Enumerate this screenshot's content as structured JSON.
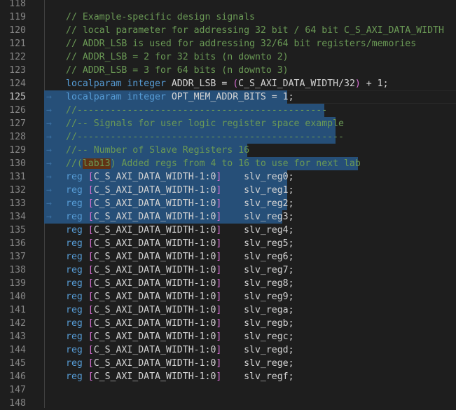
{
  "editor": {
    "lines": [
      {
        "n": "118",
        "parts": []
      },
      {
        "n": "119",
        "parts": [
          {
            "t": "// Example-specific design signals",
            "c": "comment"
          }
        ]
      },
      {
        "n": "120",
        "parts": [
          {
            "t": "// local parameter for addressing 32 bit / 64 bit C_S_AXI_DATA_WIDTH",
            "c": "comment"
          }
        ]
      },
      {
        "n": "121",
        "parts": [
          {
            "t": "// ADDR_LSB is used for addressing 32/64 bit registers/memories",
            "c": "comment"
          }
        ]
      },
      {
        "n": "122",
        "parts": [
          {
            "t": "// ADDR_LSB = 2 for 32 bits (n downto 2)",
            "c": "comment"
          }
        ]
      },
      {
        "n": "123",
        "parts": [
          {
            "t": "// ADDR_LSB = 3 for 64 bits (n downto 3)",
            "c": "comment"
          }
        ]
      },
      {
        "n": "124",
        "parts": [
          {
            "t": "localparam integer ",
            "c": "kw"
          },
          {
            "t": "ADDR_LSB = ",
            "c": "plain"
          },
          {
            "t": "(",
            "c": "bracket"
          },
          {
            "t": "C_S_AXI_DATA_WIDTH/32",
            "c": "plain"
          },
          {
            "t": ")",
            "c": "bracket"
          },
          {
            "t": " + 1;",
            "c": "plain"
          }
        ]
      },
      {
        "n": "125",
        "active": true,
        "sel": [
          0,
          347
        ],
        "parts": [
          {
            "t": "localparam integer ",
            "c": "kw"
          },
          {
            "t": "OPT_MEM_ADDR_BITS = 1;",
            "c": "plain"
          }
        ]
      },
      {
        "n": "126",
        "sel": [
          0,
          400
        ],
        "parts": [
          {
            "t": "//---------------------------------------------",
            "c": "comment"
          }
        ]
      },
      {
        "n": "127",
        "sel": [
          0,
          416
        ],
        "parts": [
          {
            "t": "//-- Signals for user logic register space example",
            "c": "comment"
          }
        ]
      },
      {
        "n": "128",
        "sel": [
          0,
          416
        ],
        "parts": [
          {
            "t": "//------------------------------------------------",
            "c": "comment"
          }
        ]
      },
      {
        "n": "129",
        "sel": [
          0,
          290
        ],
        "parts": [
          {
            "t": "//-- Number of Slave Registers 16",
            "c": "comment"
          }
        ]
      },
      {
        "n": "130",
        "sel": [
          0,
          448
        ],
        "parts": [
          {
            "t": "//(",
            "c": "comment"
          },
          {
            "t": "lab13",
            "c": "comment",
            "hl": true
          },
          {
            "t": ") Added regs from 4 to 16 to use for next lab",
            "c": "comment"
          }
        ]
      },
      {
        "n": "131",
        "sel": [
          0,
          347
        ],
        "parts": [
          {
            "t": "reg ",
            "c": "kw"
          },
          {
            "t": "[",
            "c": "bracket"
          },
          {
            "t": "C_S_AXI_DATA_WIDTH-1:0",
            "c": "plain"
          },
          {
            "t": "]",
            "c": "bracket"
          },
          {
            "t": "    slv_reg0;",
            "c": "plain"
          }
        ]
      },
      {
        "n": "132",
        "sel": [
          0,
          347
        ],
        "parts": [
          {
            "t": "reg ",
            "c": "kw"
          },
          {
            "t": "[",
            "c": "bracket"
          },
          {
            "t": "C_S_AXI_DATA_WIDTH-1:0",
            "c": "plain"
          },
          {
            "t": "]",
            "c": "bracket"
          },
          {
            "t": "    slv_reg1;",
            "c": "plain"
          }
        ]
      },
      {
        "n": "133",
        "sel": [
          0,
          347
        ],
        "parts": [
          {
            "t": "reg ",
            "c": "kw"
          },
          {
            "t": "[",
            "c": "bracket"
          },
          {
            "t": "C_S_AXI_DATA_WIDTH-1:0",
            "c": "plain"
          },
          {
            "t": "]",
            "c": "bracket"
          },
          {
            "t": "    slv_reg2;",
            "c": "plain"
          }
        ]
      },
      {
        "n": "134",
        "sel": [
          0,
          340
        ],
        "parts": [
          {
            "t": "reg ",
            "c": "kw"
          },
          {
            "t": "[",
            "c": "bracket"
          },
          {
            "t": "C_S_AXI_DATA_WIDTH-1:0",
            "c": "plain"
          },
          {
            "t": "]",
            "c": "bracket"
          },
          {
            "t": "    slv_reg3;",
            "c": "plain"
          }
        ]
      },
      {
        "n": "135",
        "parts": [
          {
            "t": "reg ",
            "c": "kw"
          },
          {
            "t": "[",
            "c": "bracket"
          },
          {
            "t": "C_S_AXI_DATA_WIDTH-1:0",
            "c": "plain"
          },
          {
            "t": "]",
            "c": "bracket"
          },
          {
            "t": "    slv_reg4;",
            "c": "plain"
          }
        ]
      },
      {
        "n": "136",
        "parts": [
          {
            "t": "reg ",
            "c": "kw"
          },
          {
            "t": "[",
            "c": "bracket"
          },
          {
            "t": "C_S_AXI_DATA_WIDTH-1:0",
            "c": "plain"
          },
          {
            "t": "]",
            "c": "bracket"
          },
          {
            "t": "    slv_reg5;",
            "c": "plain"
          }
        ]
      },
      {
        "n": "137",
        "parts": [
          {
            "t": "reg ",
            "c": "kw"
          },
          {
            "t": "[",
            "c": "bracket"
          },
          {
            "t": "C_S_AXI_DATA_WIDTH-1:0",
            "c": "plain"
          },
          {
            "t": "]",
            "c": "bracket"
          },
          {
            "t": "    slv_reg6;",
            "c": "plain"
          }
        ]
      },
      {
        "n": "138",
        "parts": [
          {
            "t": "reg ",
            "c": "kw"
          },
          {
            "t": "[",
            "c": "bracket"
          },
          {
            "t": "C_S_AXI_DATA_WIDTH-1:0",
            "c": "plain"
          },
          {
            "t": "]",
            "c": "bracket"
          },
          {
            "t": "    slv_reg7;",
            "c": "plain"
          }
        ]
      },
      {
        "n": "139",
        "parts": [
          {
            "t": "reg ",
            "c": "kw"
          },
          {
            "t": "[",
            "c": "bracket"
          },
          {
            "t": "C_S_AXI_DATA_WIDTH-1:0",
            "c": "plain"
          },
          {
            "t": "]",
            "c": "bracket"
          },
          {
            "t": "    slv_reg8;",
            "c": "plain"
          }
        ]
      },
      {
        "n": "140",
        "parts": [
          {
            "t": "reg ",
            "c": "kw"
          },
          {
            "t": "[",
            "c": "bracket"
          },
          {
            "t": "C_S_AXI_DATA_WIDTH-1:0",
            "c": "plain"
          },
          {
            "t": "]",
            "c": "bracket"
          },
          {
            "t": "    slv_reg9;",
            "c": "plain"
          }
        ]
      },
      {
        "n": "141",
        "parts": [
          {
            "t": "reg ",
            "c": "kw"
          },
          {
            "t": "[",
            "c": "bracket"
          },
          {
            "t": "C_S_AXI_DATA_WIDTH-1:0",
            "c": "plain"
          },
          {
            "t": "]",
            "c": "bracket"
          },
          {
            "t": "    slv_rega;",
            "c": "plain"
          }
        ]
      },
      {
        "n": "142",
        "parts": [
          {
            "t": "reg ",
            "c": "kw"
          },
          {
            "t": "[",
            "c": "bracket"
          },
          {
            "t": "C_S_AXI_DATA_WIDTH-1:0",
            "c": "plain"
          },
          {
            "t": "]",
            "c": "bracket"
          },
          {
            "t": "    slv_regb;",
            "c": "plain"
          }
        ]
      },
      {
        "n": "143",
        "parts": [
          {
            "t": "reg ",
            "c": "kw"
          },
          {
            "t": "[",
            "c": "bracket"
          },
          {
            "t": "C_S_AXI_DATA_WIDTH-1:0",
            "c": "plain"
          },
          {
            "t": "]",
            "c": "bracket"
          },
          {
            "t": "    slv_regc;",
            "c": "plain"
          }
        ]
      },
      {
        "n": "144",
        "parts": [
          {
            "t": "reg ",
            "c": "kw"
          },
          {
            "t": "[",
            "c": "bracket"
          },
          {
            "t": "C_S_AXI_DATA_WIDTH-1:0",
            "c": "plain"
          },
          {
            "t": "]",
            "c": "bracket"
          },
          {
            "t": "    slv_regd;",
            "c": "plain"
          }
        ]
      },
      {
        "n": "145",
        "parts": [
          {
            "t": "reg ",
            "c": "kw"
          },
          {
            "t": "[",
            "c": "bracket"
          },
          {
            "t": "C_S_AXI_DATA_WIDTH-1:0",
            "c": "plain"
          },
          {
            "t": "]",
            "c": "bracket"
          },
          {
            "t": "    slv_rege;",
            "c": "plain"
          }
        ]
      },
      {
        "n": "146",
        "parts": [
          {
            "t": "reg ",
            "c": "kw"
          },
          {
            "t": "[",
            "c": "bracket"
          },
          {
            "t": "C_S_AXI_DATA_WIDTH-1:0",
            "c": "plain"
          },
          {
            "t": "]",
            "c": "bracket"
          },
          {
            "t": "    slv_regf;",
            "c": "plain"
          }
        ]
      },
      {
        "n": "147",
        "parts": []
      },
      {
        "n": "148",
        "parts": []
      }
    ]
  }
}
